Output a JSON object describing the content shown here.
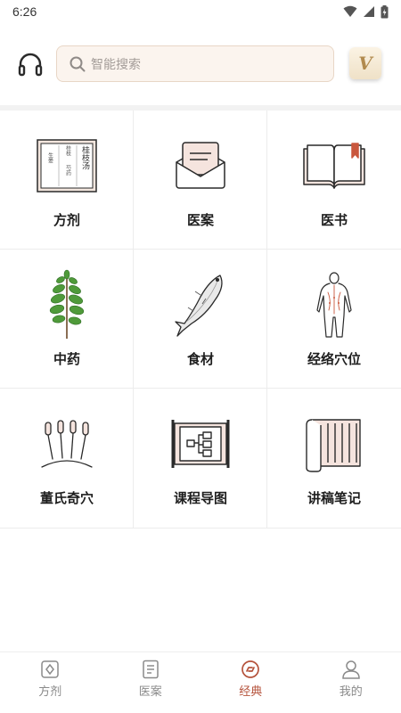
{
  "status_bar": {
    "time": "6:26"
  },
  "header": {
    "search_placeholder": "智能搜索",
    "vip_letter": "V"
  },
  "grid": {
    "items": [
      {
        "label": "方剂"
      },
      {
        "label": "医案"
      },
      {
        "label": "医书"
      },
      {
        "label": "中药"
      },
      {
        "label": "食材"
      },
      {
        "label": "经络穴位"
      },
      {
        "label": "董氏奇穴"
      },
      {
        "label": "课程导图"
      },
      {
        "label": "讲稿笔记"
      }
    ],
    "fangji_icon_text": {
      "main": "桂枝汤",
      "col1": "桂枝",
      "col2": "芍药",
      "col3": "生姜"
    }
  },
  "bottom_nav": {
    "items": [
      {
        "label": "方剂"
      },
      {
        "label": "医案"
      },
      {
        "label": "经典"
      },
      {
        "label": "我的"
      }
    ],
    "active_color": "#b5533c",
    "inactive_color": "#8a8a8a"
  }
}
